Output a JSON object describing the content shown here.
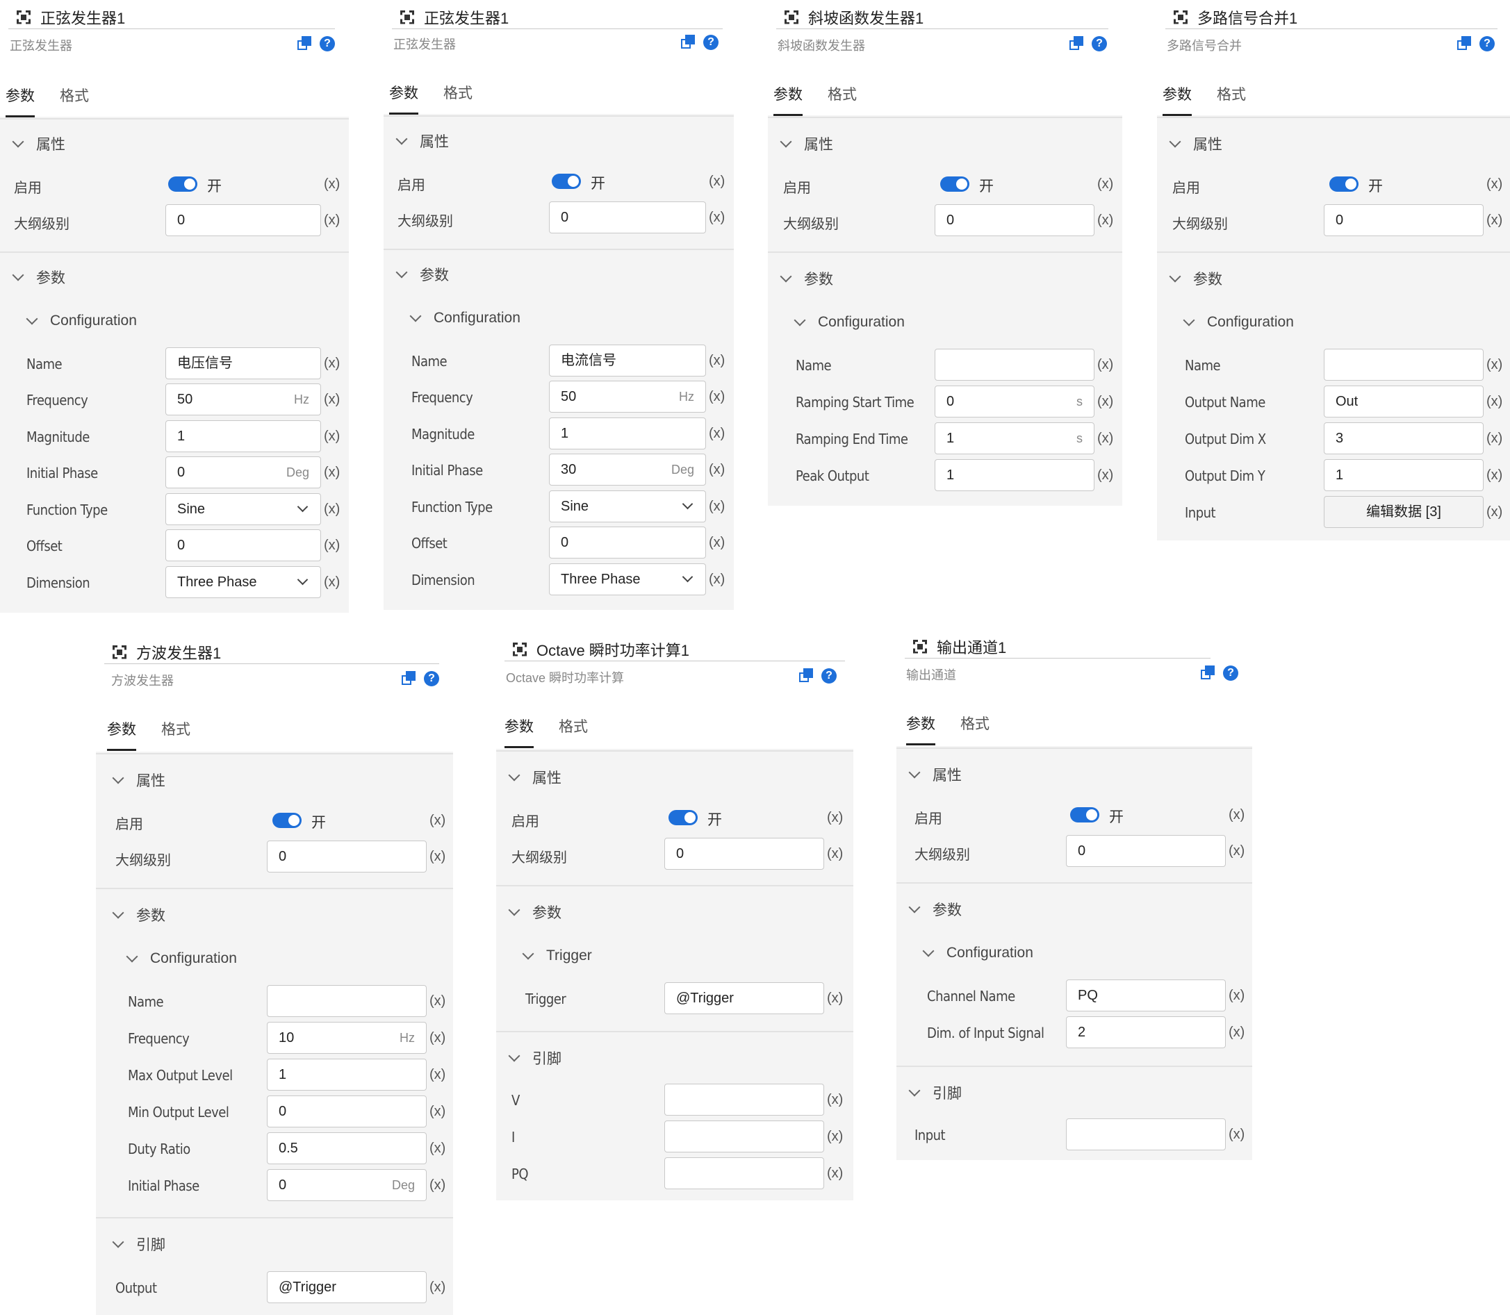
{
  "common": {
    "tab_params": "参数",
    "tab_format": "格式",
    "section_attrs": "属性",
    "section_params": "参数",
    "section_pins": "引脚",
    "label_enable": "启用",
    "label_outline": "大纲级别",
    "toggle_on": "开",
    "x_marker": "(x)",
    "help_glyph": "?",
    "icons": [
      "block-icon",
      "copy-icon",
      "help-icon",
      "chevron-down-icon",
      "toggle-switch"
    ]
  },
  "panels": {
    "sine1": {
      "title": "正弦发生器1",
      "subtitle": "正弦发生器",
      "outline": "0",
      "config_title": "Configuration",
      "fields": {
        "name": {
          "label": "Name",
          "value": "电压信号"
        },
        "frequency": {
          "label": "Frequency",
          "value": "50",
          "unit": "Hz"
        },
        "magnitude": {
          "label": "Magnitude",
          "value": "1"
        },
        "phase": {
          "label": "Initial Phase",
          "value": "0",
          "unit": "Deg"
        },
        "function_type": {
          "label": "Function Type",
          "value": "Sine"
        },
        "offset": {
          "label": "Offset",
          "value": "0"
        },
        "dimension": {
          "label": "Dimension",
          "value": "Three Phase"
        }
      }
    },
    "sine2": {
      "title": "正弦发生器1",
      "subtitle": "正弦发生器",
      "outline": "0",
      "config_title": "Configuration",
      "fields": {
        "name": {
          "label": "Name",
          "value": "电流信号"
        },
        "frequency": {
          "label": "Frequency",
          "value": "50",
          "unit": "Hz"
        },
        "magnitude": {
          "label": "Magnitude",
          "value": "1"
        },
        "phase": {
          "label": "Initial Phase",
          "value": "30",
          "unit": "Deg"
        },
        "function_type": {
          "label": "Function Type",
          "value": "Sine"
        },
        "offset": {
          "label": "Offset",
          "value": "0"
        },
        "dimension": {
          "label": "Dimension",
          "value": "Three Phase"
        }
      }
    },
    "ramp": {
      "title": "斜坡函数发生器1",
      "subtitle": "斜坡函数发生器",
      "outline": "0",
      "config_title": "Configuration",
      "fields": {
        "name": {
          "label": "Name",
          "value": ""
        },
        "start": {
          "label": "Ramping Start Time",
          "value": "0",
          "unit": "s"
        },
        "end": {
          "label": "Ramping End Time",
          "value": "1",
          "unit": "s"
        },
        "peak": {
          "label": "Peak Output",
          "value": "1"
        }
      }
    },
    "mux": {
      "title": "多路信号合并1",
      "subtitle": "多路信号合并",
      "outline": "0",
      "config_title": "Configuration",
      "fields": {
        "name": {
          "label": "Name",
          "value": ""
        },
        "output_name": {
          "label": "Output Name",
          "value": "Out"
        },
        "dim_x": {
          "label": "Output Dim X",
          "value": "3"
        },
        "dim_y": {
          "label": "Output Dim Y",
          "value": "1"
        },
        "input": {
          "label": "Input",
          "value": "编辑数据 [3]"
        }
      }
    },
    "square": {
      "title": "方波发生器1",
      "subtitle": "方波发生器",
      "outline": "0",
      "config_title": "Configuration",
      "fields": {
        "name": {
          "label": "Name",
          "value": ""
        },
        "frequency": {
          "label": "Frequency",
          "value": "10",
          "unit": "Hz"
        },
        "max": {
          "label": "Max Output Level",
          "value": "1"
        },
        "min": {
          "label": "Min Output Level",
          "value": "0"
        },
        "duty": {
          "label": "Duty Ratio",
          "value": "0.5"
        },
        "phase": {
          "label": "Initial Phase",
          "value": "0",
          "unit": "Deg"
        }
      },
      "pins": {
        "output": {
          "label": "Output",
          "value": "@Trigger"
        }
      }
    },
    "octave": {
      "title": "Octave 瞬时功率计算1",
      "subtitle": "Octave 瞬时功率计算",
      "outline": "0",
      "trigger_title": "Trigger",
      "fields": {
        "trigger": {
          "label": "Trigger",
          "value": "@Trigger"
        }
      },
      "pins": {
        "v": {
          "label": "V",
          "value": ""
        },
        "i": {
          "label": "I",
          "value": ""
        },
        "pq": {
          "label": "PQ",
          "value": ""
        }
      }
    },
    "output": {
      "title": "输出通道1",
      "subtitle": "输出通道",
      "outline": "0",
      "config_title": "Configuration",
      "fields": {
        "channel": {
          "label": "Channel Name",
          "value": "PQ"
        },
        "dim": {
          "label": "Dim. of Input Signal",
          "value": "2"
        }
      },
      "pins": {
        "input": {
          "label": "Input",
          "value": ""
        }
      }
    }
  }
}
